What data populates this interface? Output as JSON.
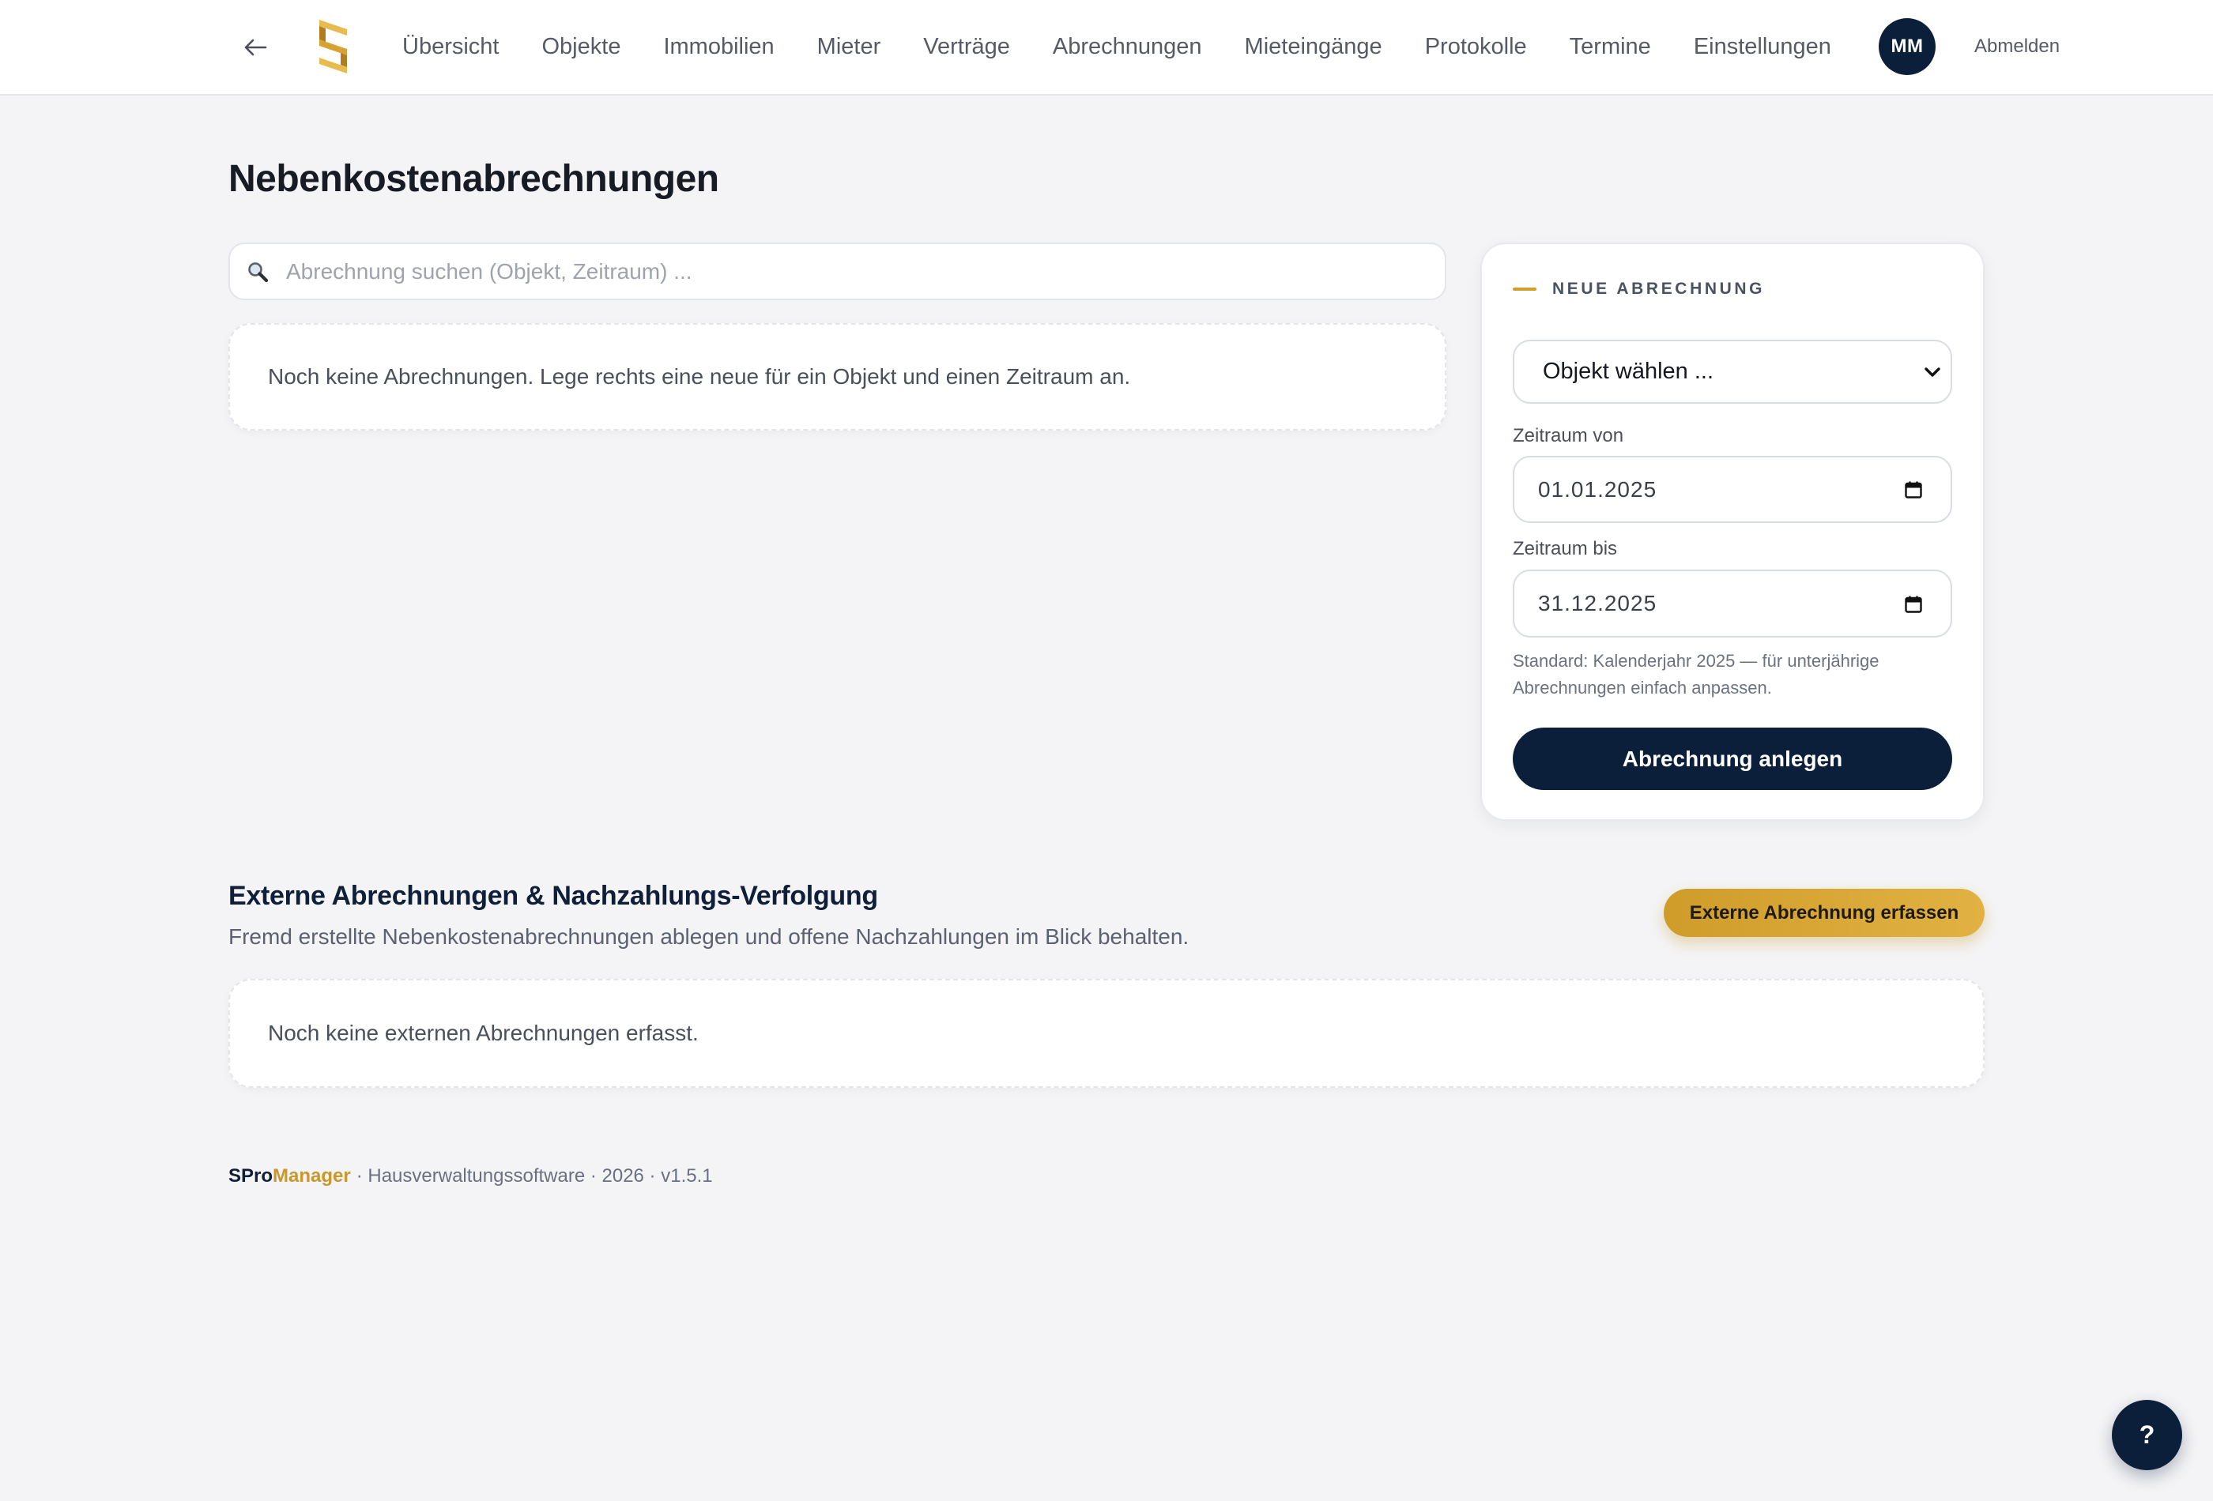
{
  "header": {
    "back_icon": "arrow-left-icon",
    "logo_icon": "spro-logo-icon",
    "nav": [
      {
        "label": "Übersicht"
      },
      {
        "label": "Objekte"
      },
      {
        "label": "Immobilien"
      },
      {
        "label": "Mieter"
      },
      {
        "label": "Verträge"
      },
      {
        "label": "Abrechnungen"
      },
      {
        "label": "Mieteingänge"
      },
      {
        "label": "Protokolle"
      },
      {
        "label": "Termine"
      },
      {
        "label": "Einstellungen"
      }
    ],
    "avatar_initials": "MM",
    "logout_label": "Abmelden"
  },
  "page_title": "Nebenkostenabrechnungen",
  "search": {
    "icon": "search-icon",
    "placeholder": "Abrechnung suchen (Objekt, Zeitraum) ..."
  },
  "list": {
    "empty_message": "Noch keine Abrechnungen. Lege rechts eine neue für ein Objekt und einen Zeitraum an."
  },
  "new_form": {
    "heading": "NEUE ABRECHNUNG",
    "object_select": {
      "selected": "Objekt wählen ...",
      "icon": "chevron-down-icon"
    },
    "date_from": {
      "label": "Zeitraum von",
      "value": "01.01.2025",
      "icon": "calendar-icon"
    },
    "date_to": {
      "label": "Zeitraum bis",
      "value": "31.12.2025",
      "icon": "calendar-icon"
    },
    "hint": "Standard: Kalenderjahr 2025 — für unterjährige Abrechnungen einfach anpassen.",
    "submit_label": "Abrechnung anlegen"
  },
  "external": {
    "title": "Externe Abrechnungen & Nachzahlungs-Verfolgung",
    "subtitle": "Fremd erstellte Nebenkostenabrechnungen ablegen und offene Nachzahlungen im Blick behalten.",
    "add_button_label": "Externe Abrechnung erfassen",
    "empty_message": "Noch keine externen Abrechnungen erfasst."
  },
  "footer": {
    "brand_part1": "SPro",
    "brand_part2": "Manager",
    "info": "· Hausverwaltungssoftware · 2026 · v1.5.1"
  },
  "help_button": {
    "label": "?"
  },
  "theme": {
    "navy": "#0c1f3a",
    "gold": "#d4a12e",
    "page_background": "#f4f4f6"
  }
}
